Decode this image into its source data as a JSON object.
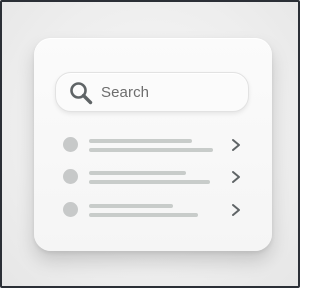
{
  "search": {
    "placeholder": "Search",
    "icon": "search-icon"
  },
  "list": {
    "items": [
      {
        "icon": "circle-placeholder",
        "trailing_icon": "chevron-right-icon"
      },
      {
        "icon": "circle-placeholder",
        "trailing_icon": "chevron-right-icon"
      },
      {
        "icon": "circle-placeholder",
        "trailing_icon": "chevron-right-icon"
      }
    ]
  },
  "colors": {
    "background": "#eeeeee",
    "card": "#f8f8f8",
    "placeholder_gray": "#c8ccca",
    "icon_gray": "#5f6466",
    "frame_border": "#2b2f36"
  }
}
